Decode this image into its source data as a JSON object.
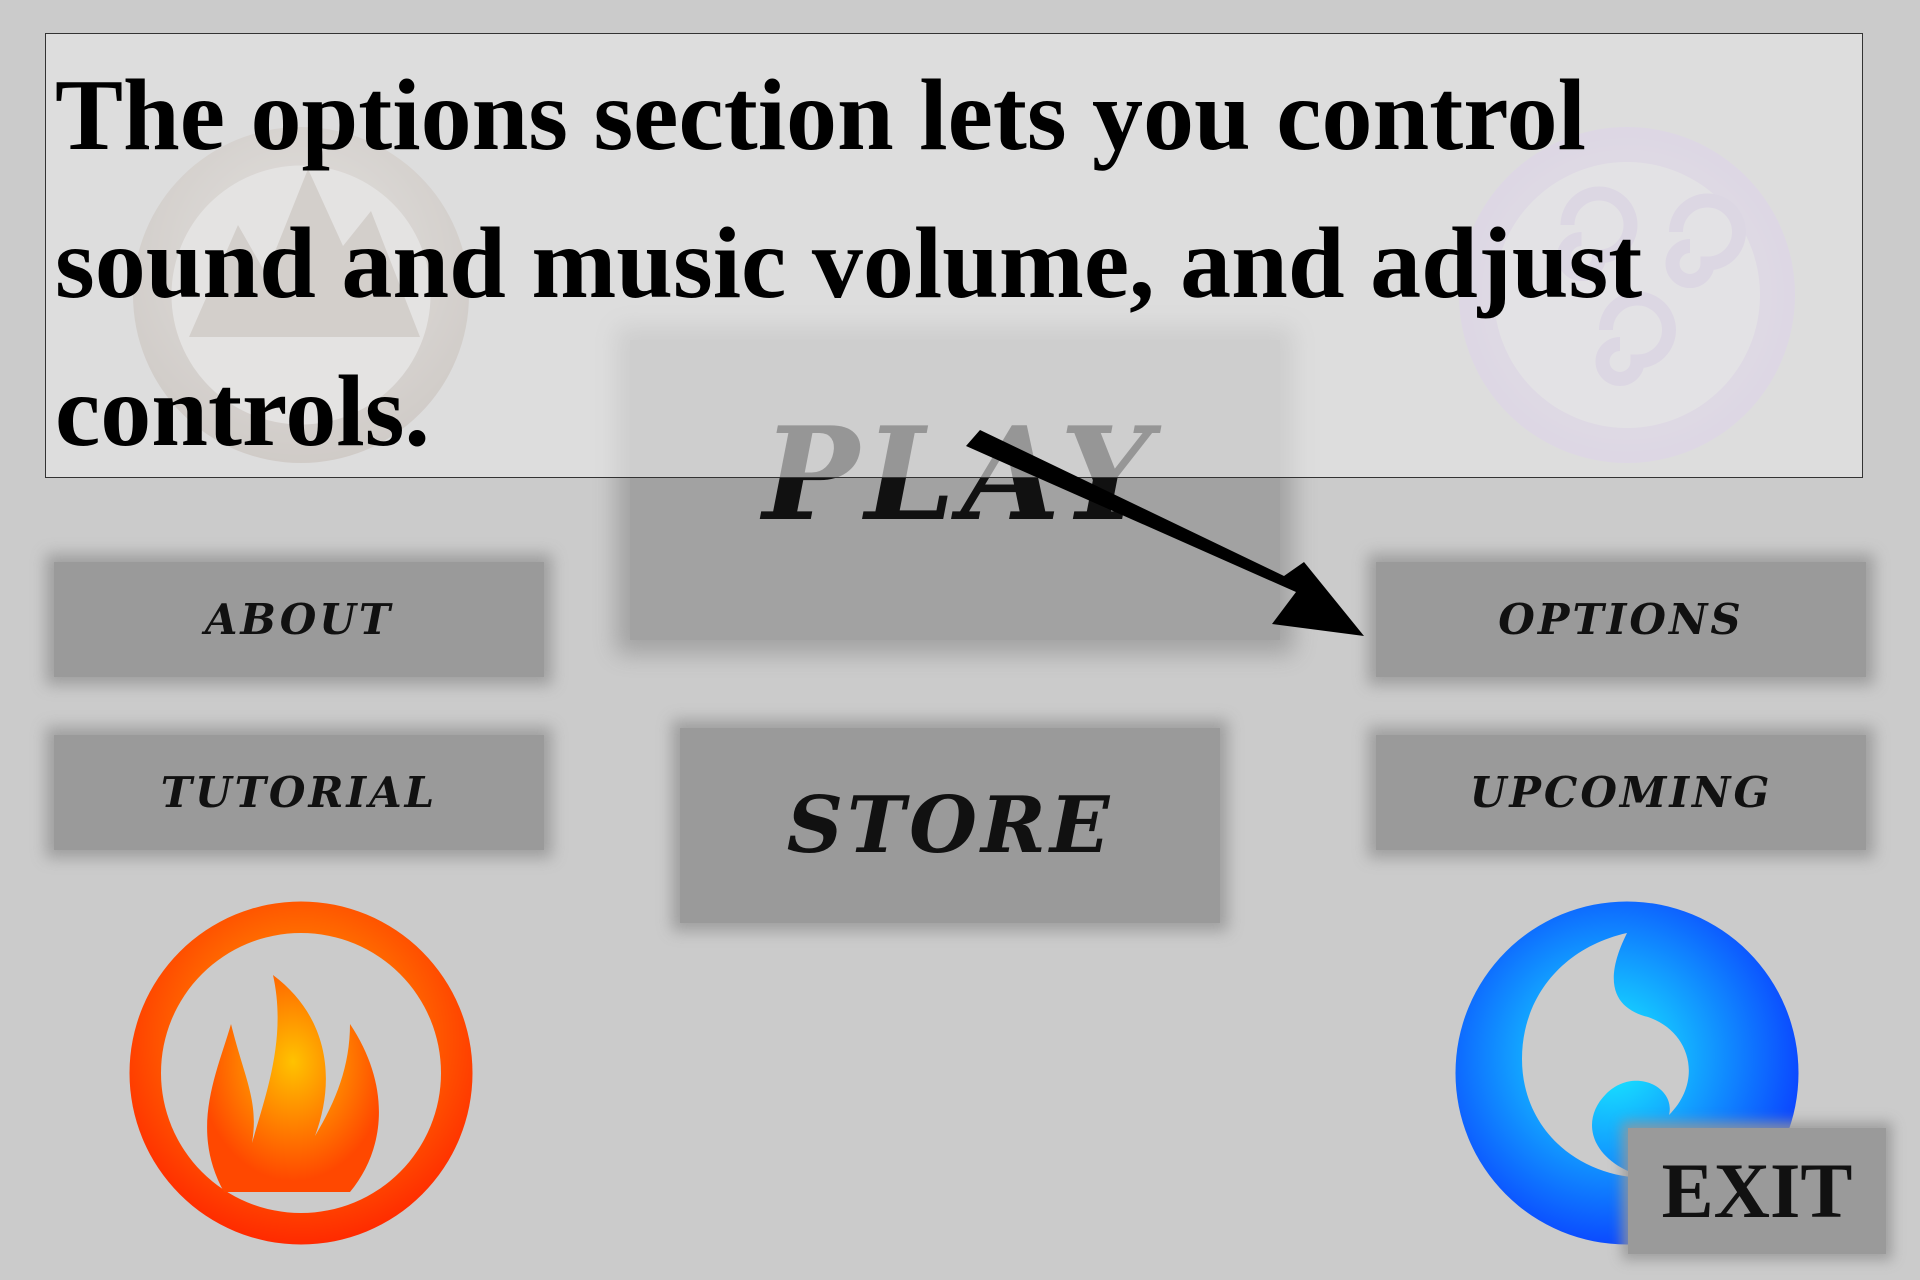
{
  "tutorial": {
    "text": "The options section lets you control sound and music volume, and adjust controls."
  },
  "menu": {
    "play": "PLAY",
    "about": "ABOUT",
    "tutorial": "TUTORIAL",
    "store": "STORE",
    "options": "OPTIONS",
    "upcoming": "UPCOMING",
    "exit": "EXIT"
  },
  "emblems": [
    {
      "name": "earth-emblem-icon",
      "color": "#a08f7e"
    },
    {
      "name": "air-emblem-icon",
      "color": "#c9a8f2"
    },
    {
      "name": "fire-emblem-icon",
      "color": "#ff5a00"
    },
    {
      "name": "water-emblem-icon",
      "color": "#1e6fff"
    }
  ],
  "colors": {
    "background": "#cbcbcb",
    "button": "#9a9a9a",
    "text": "#111111"
  }
}
